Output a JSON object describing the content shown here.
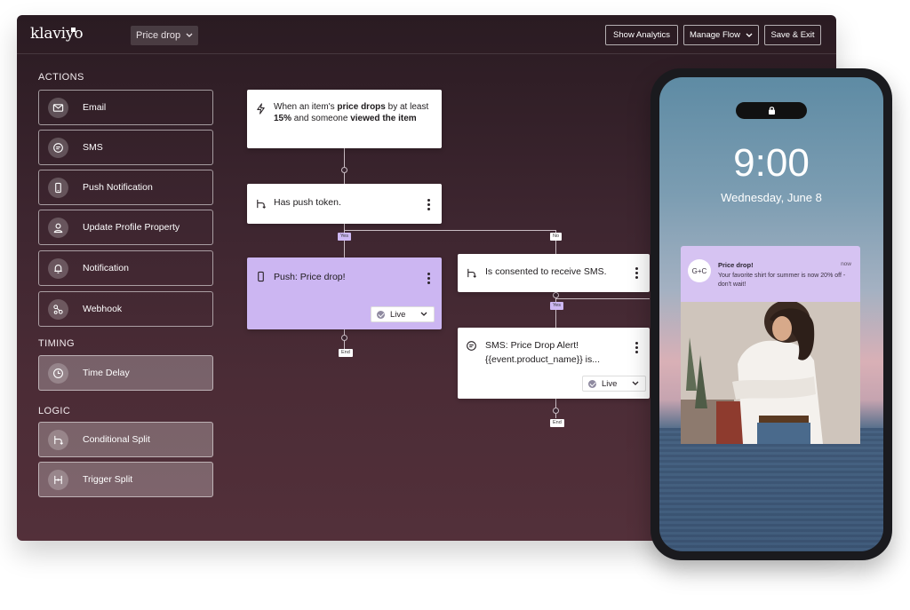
{
  "app": {
    "logo": "klaviyo",
    "flow_name": "Price drop",
    "buttons": {
      "show_analytics": "Show Analytics",
      "manage_flow": "Manage Flow",
      "save_exit": "Save & Exit"
    }
  },
  "sidebar": {
    "actions_title": "ACTIONS",
    "actions": [
      {
        "label": "Email",
        "icon": "mail-icon"
      },
      {
        "label": "SMS",
        "icon": "chat-icon"
      },
      {
        "label": "Push Notification",
        "icon": "phone-icon"
      },
      {
        "label": "Update Profile Property",
        "icon": "person-icon"
      },
      {
        "label": "Notification",
        "icon": "bell-icon"
      },
      {
        "label": "Webhook",
        "icon": "webhook-icon"
      }
    ],
    "timing_title": "TIMING",
    "timing": [
      {
        "label": "Time Delay",
        "icon": "clock-icon"
      }
    ],
    "logic_title": "LOGIC",
    "logic": [
      {
        "label": "Conditional Split",
        "icon": "split-icon"
      },
      {
        "label": "Trigger Split",
        "icon": "trigger-split-icon"
      }
    ]
  },
  "canvas": {
    "trigger": {
      "p1": "When an item's ",
      "b1": "price drops",
      "p2": " by at least ",
      "b2": "15%",
      "p3": " and someone ",
      "b3": "viewed the item"
    },
    "split1": "Has push token.",
    "yes": "Yes",
    "no": "No",
    "push": {
      "title": "Push: Price drop!",
      "status": "Live"
    },
    "split2": "Is consented to receive SMS.",
    "sms": {
      "title": "SMS: Price Drop Alert!",
      "subtitle": "{{event.product_name}} is...",
      "status": "Live"
    },
    "end": "End"
  },
  "phone": {
    "time": "9:00",
    "date": "Wednesday, June 8",
    "notification": {
      "avatar": "G+C",
      "title": "Price drop!",
      "when": "now",
      "body": "Your favorite shirt for summer is now 20% off - don't wait!"
    }
  },
  "colors": {
    "accent_purple": "#ccb6f2",
    "window_top": "#2a1b22",
    "window_bottom": "#53303a"
  }
}
